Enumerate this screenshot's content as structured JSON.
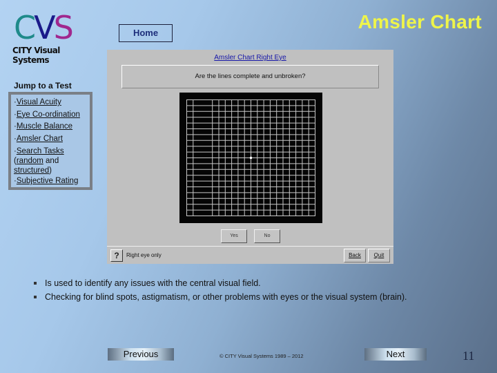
{
  "logo": {
    "letters": [
      "C",
      "V",
      "S"
    ],
    "subtitle": "CITY Visual Systems"
  },
  "header": {
    "home_label": "Home",
    "title": "Amsler Chart"
  },
  "jump": {
    "title": "Jump to a Test",
    "items": [
      {
        "label": "Visual Acuity"
      },
      {
        "label": "Eye Co-ordination"
      },
      {
        "label": "Muscle Balance"
      },
      {
        "label": "Amsler Chart"
      },
      {
        "label": "Search Tasks"
      },
      {
        "label": "Subjective Rating"
      }
    ],
    "search_extra": {
      "open": "(",
      "random": "random",
      "and": " and",
      "structured": "structured",
      "close": ")"
    },
    "bullet": "·"
  },
  "app": {
    "heading": "Amsler Chart Right Eye",
    "question": "Are the lines complete and unbroken?",
    "grid": {
      "cells": 20,
      "missing_vertical_lines": [
        2,
        3
      ],
      "line_color": "#c8c8c8",
      "fixation_dot": "center"
    },
    "yes_label": "Yes",
    "no_label": "No",
    "help_icon": "?",
    "status": "Right eye only",
    "back_label": "Back",
    "quit_label": "Quit"
  },
  "bullets": [
    "Is used  to identify any issues with the central visual field.",
    "Checking for blind spots, astigmatism, or other problems with eyes or the visual system (brain)."
  ],
  "footer": {
    "previous_label": "Previous",
    "copyright": "© CITY Visual Systems 1989 – 2012",
    "next_label": "Next",
    "page_number": "11"
  }
}
